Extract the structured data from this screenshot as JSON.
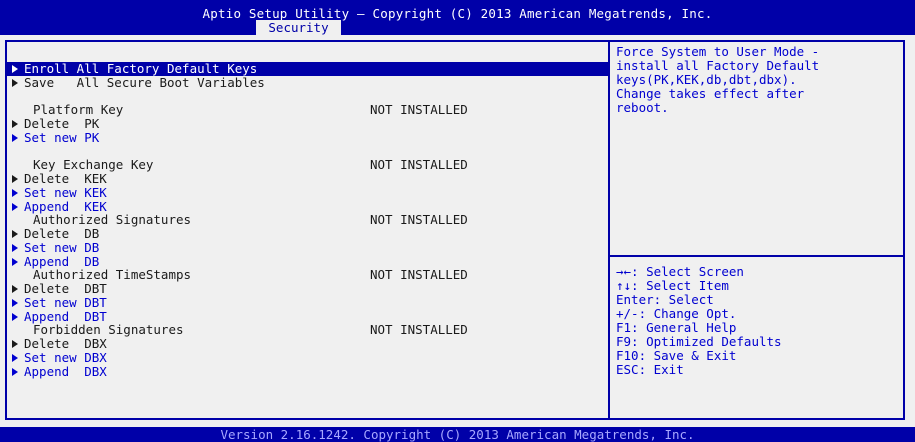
{
  "header": {
    "title": "Aptio Setup Utility – Copyright (C) 2013 American Megatrends, Inc.",
    "tab": "Security"
  },
  "menu": [
    {
      "label": "Enroll All Factory Default Keys",
      "arrow": true,
      "style": "active",
      "value": ""
    },
    {
      "label": "Save   All Secure Boot Variables",
      "arrow": true,
      "style": "normal",
      "value": ""
    },
    {
      "label": "",
      "arrow": false,
      "style": "normal",
      "value": ""
    },
    {
      "label": "Platform Key",
      "arrow": false,
      "style": "normal",
      "value": "NOT INSTALLED"
    },
    {
      "label": "Delete  PK",
      "arrow": true,
      "style": "normal",
      "value": ""
    },
    {
      "label": "Set new PK",
      "arrow": true,
      "style": "blue",
      "value": ""
    },
    {
      "label": "",
      "arrow": false,
      "style": "normal",
      "value": ""
    },
    {
      "label": "Key Exchange Key",
      "arrow": false,
      "style": "normal",
      "value": "NOT INSTALLED"
    },
    {
      "label": "Delete  KEK",
      "arrow": true,
      "style": "normal",
      "value": ""
    },
    {
      "label": "Set new KEK",
      "arrow": true,
      "style": "blue",
      "value": ""
    },
    {
      "label": "Append  KEK",
      "arrow": true,
      "style": "blue",
      "value": ""
    },
    {
      "label": "Authorized Signatures",
      "arrow": false,
      "style": "normal",
      "value": "NOT INSTALLED"
    },
    {
      "label": "Delete  DB",
      "arrow": true,
      "style": "normal",
      "value": ""
    },
    {
      "label": "Set new DB",
      "arrow": true,
      "style": "blue",
      "value": ""
    },
    {
      "label": "Append  DB",
      "arrow": true,
      "style": "blue",
      "value": ""
    },
    {
      "label": "Authorized TimeStamps",
      "arrow": false,
      "style": "normal",
      "value": "NOT INSTALLED"
    },
    {
      "label": "Delete  DBT",
      "arrow": true,
      "style": "normal",
      "value": ""
    },
    {
      "label": "Set new DBT",
      "arrow": true,
      "style": "blue",
      "value": ""
    },
    {
      "label": "Append  DBT",
      "arrow": true,
      "style": "blue",
      "value": ""
    },
    {
      "label": "Forbidden Signatures",
      "arrow": false,
      "style": "normal",
      "value": "NOT INSTALLED"
    },
    {
      "label": "Delete  DBX",
      "arrow": true,
      "style": "normal",
      "value": ""
    },
    {
      "label": "Set new DBX",
      "arrow": true,
      "style": "blue",
      "value": ""
    },
    {
      "label": "Append  DBX",
      "arrow": true,
      "style": "blue",
      "value": ""
    }
  ],
  "help_text": "Force System to User Mode -\ninstall all Factory Default\nkeys(PK,KEK,db,dbt,dbx).\nChange takes effect after\nreboot.",
  "key_help": [
    "→←: Select Screen",
    "↑↓: Select Item",
    "Enter: Select",
    "+/-: Change Opt.",
    "F1: General Help",
    "F9: Optimized Defaults",
    "F10: Save & Exit",
    "ESC: Exit"
  ],
  "footer": "Version 2.16.1242. Copyright (C) 2013 American Megatrends, Inc.",
  "colors": {
    "bios_blue": "#0000a8",
    "link_blue": "#0000d0",
    "background": "#f0f0f0"
  }
}
